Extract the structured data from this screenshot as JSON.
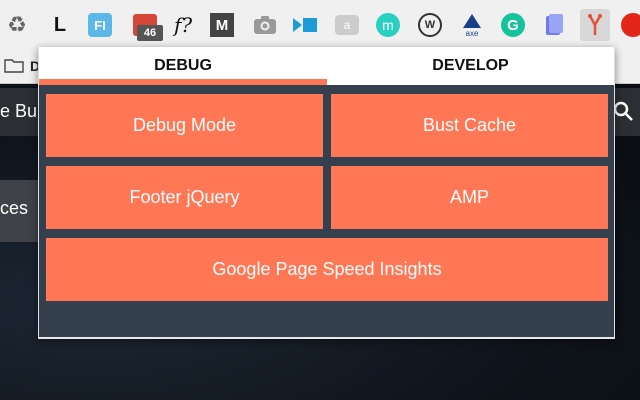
{
  "browser": {
    "extensions": [
      {
        "icon": "recycle-icon",
        "glyph": "♻"
      },
      {
        "icon": "l-logo-icon",
        "glyph": "L"
      },
      {
        "icon": "fi-logo-icon",
        "glyph": "FI"
      },
      {
        "icon": "gmail-icon",
        "glyph": "",
        "badge": "46"
      },
      {
        "icon": "font-ninja-icon",
        "glyph": "f?"
      },
      {
        "icon": "m-logo-icon",
        "glyph": "M"
      },
      {
        "icon": "camera-icon",
        "glyph": ""
      },
      {
        "icon": "video-icon",
        "glyph": ""
      },
      {
        "icon": "caption-icon",
        "glyph": "a"
      },
      {
        "icon": "m-circle-icon",
        "glyph": "m"
      },
      {
        "icon": "w-circle-icon",
        "glyph": "W"
      },
      {
        "icon": "axe-icon",
        "glyph": "axe"
      },
      {
        "icon": "grammarly-icon",
        "glyph": "G"
      },
      {
        "icon": "bookmark-tool-icon",
        "glyph": ""
      },
      {
        "icon": "debug-develop-icon",
        "glyph": ""
      },
      {
        "icon": "stop-icon",
        "glyph": ""
      }
    ],
    "bookmarks_text": "D"
  },
  "page": {
    "header_text": "e Bu",
    "side_text": "ces"
  },
  "popup": {
    "tabs": [
      {
        "label": "DEBUG",
        "active": true
      },
      {
        "label": "DEVELOP",
        "active": false
      }
    ],
    "buttons": {
      "debug_mode": "Debug Mode",
      "bust_cache": "Bust Cache",
      "footer_jquery": "Footer jQuery",
      "amp": "AMP",
      "page_speed": "Google Page Speed Insights"
    },
    "accent_color": "#ff7755",
    "panel_color": "#34404e"
  }
}
